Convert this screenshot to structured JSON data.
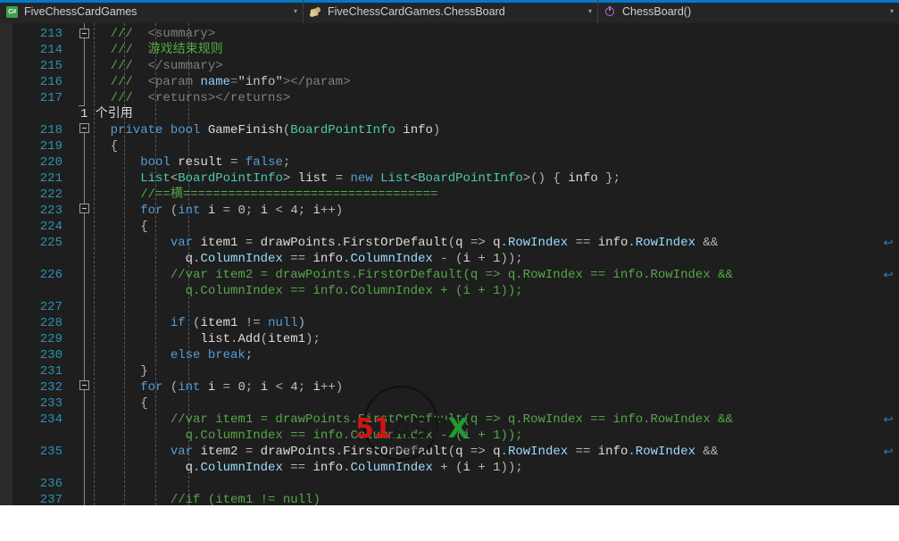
{
  "navbar": {
    "accent_color": "#007acc",
    "project": {
      "icon": "csharp-project-icon",
      "label": "FiveChessCardGames",
      "arrow": "▾"
    },
    "class": {
      "icon": "class-icon",
      "label": "FiveChessCardGames.ChessBoard",
      "arrow": "▾"
    },
    "member": {
      "icon": "method-icon",
      "label": "ChessBoard()",
      "arrow": "▾"
    }
  },
  "editor": {
    "theme": {
      "background": "#1e1e1e",
      "line_number_color": "#2b91af",
      "comment_color": "#57a64a",
      "keyword_color": "#569cd6",
      "type_color": "#4ec9b0",
      "string_color": "#d69d85"
    },
    "reference_hint": "1 个引用",
    "lines": [
      {
        "n": "213",
        "code": "        ///  <summary>"
      },
      {
        "n": "214",
        "code": "        ///  游戏结束规则"
      },
      {
        "n": "215",
        "code": "        ///  </summary>"
      },
      {
        "n": "216",
        "code": "        ///  <param name=\"info\"></param>"
      },
      {
        "n": "217",
        "code": "        ///  <returns></returns>"
      },
      {
        "n": "",
        "code": "        1 个引用"
      },
      {
        "n": "218",
        "code": "        private bool GameFinish(BoardPointInfo info)"
      },
      {
        "n": "219",
        "code": "        {"
      },
      {
        "n": "220",
        "code": "            bool result = false;"
      },
      {
        "n": "221",
        "code": "            List<BoardPointInfo> list = new List<BoardPointInfo>() { info };"
      },
      {
        "n": "222",
        "code": "            //==横=================================="
      },
      {
        "n": "223",
        "code": "            for (int i = 0; i < 4; i++)"
      },
      {
        "n": "224",
        "code": "            {"
      },
      {
        "n": "225",
        "code": "                var item1 = drawPoints.FirstOrDefault(q => q.RowIndex == info.RowIndex &&"
      },
      {
        "n": "",
        "code": "                  q.ColumnIndex == info.ColumnIndex - (i + 1));"
      },
      {
        "n": "226",
        "code": "                //var item2 = drawPoints.FirstOrDefault(q => q.RowIndex == info.RowIndex &&"
      },
      {
        "n": "",
        "code": "                  q.ColumnIndex == info.ColumnIndex + (i + 1));"
      },
      {
        "n": "227",
        "code": ""
      },
      {
        "n": "228",
        "code": "                if (item1 != null)"
      },
      {
        "n": "229",
        "code": "                    list.Add(item1);"
      },
      {
        "n": "230",
        "code": "                else break;"
      },
      {
        "n": "231",
        "code": "            }"
      },
      {
        "n": "232",
        "code": "            for (int i = 0; i < 4; i++)"
      },
      {
        "n": "233",
        "code": "            {"
      },
      {
        "n": "234",
        "code": "                //var item1 = drawPoints.FirstOrDefault(q => q.RowIndex == info.RowIndex &&"
      },
      {
        "n": "",
        "code": "                  q.ColumnIndex == info.ColumnIndex - (i + 1));"
      },
      {
        "n": "235",
        "code": "                var item2 = drawPoints.FirstOrDefault(q => q.RowIndex == info.RowIndex &&"
      },
      {
        "n": "",
        "code": "                  q.ColumnIndex == info.ColumnIndex + (i + 1));"
      },
      {
        "n": "236",
        "code": ""
      },
      {
        "n": "237",
        "code": "                //if (item1 != null)"
      }
    ],
    "wrap_indicator_glyph": "↩",
    "collapse_glyph": "−"
  },
  "watermark": {
    "part1": "51",
    "part2": "ASP",
    "part3": "X",
    "sub": "中国源码网"
  }
}
